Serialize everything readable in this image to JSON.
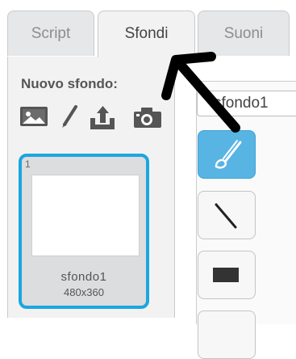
{
  "tabs": [
    {
      "label": "Script",
      "active": false
    },
    {
      "label": "Sfondi",
      "active": true
    },
    {
      "label": "Suoni",
      "active": false
    }
  ],
  "sidebar": {
    "new_backdrop_label": "Nuovo sfondo:",
    "tools": [
      "image-library-icon",
      "paint-brush-icon",
      "upload-icon",
      "camera-icon"
    ]
  },
  "backdrops": [
    {
      "index": "1",
      "name": "sfondo1",
      "size": "480x360",
      "selected": true
    }
  ],
  "editor": {
    "costume_name_value": "sfondo1",
    "tools": [
      "brush-icon",
      "line-icon",
      "rectangle-icon"
    ],
    "selected_tool": "brush-icon"
  },
  "colors": {
    "accent": "#1ba6e0",
    "selected_tool_bg": "#58b4e3",
    "arrow": "#000000"
  }
}
